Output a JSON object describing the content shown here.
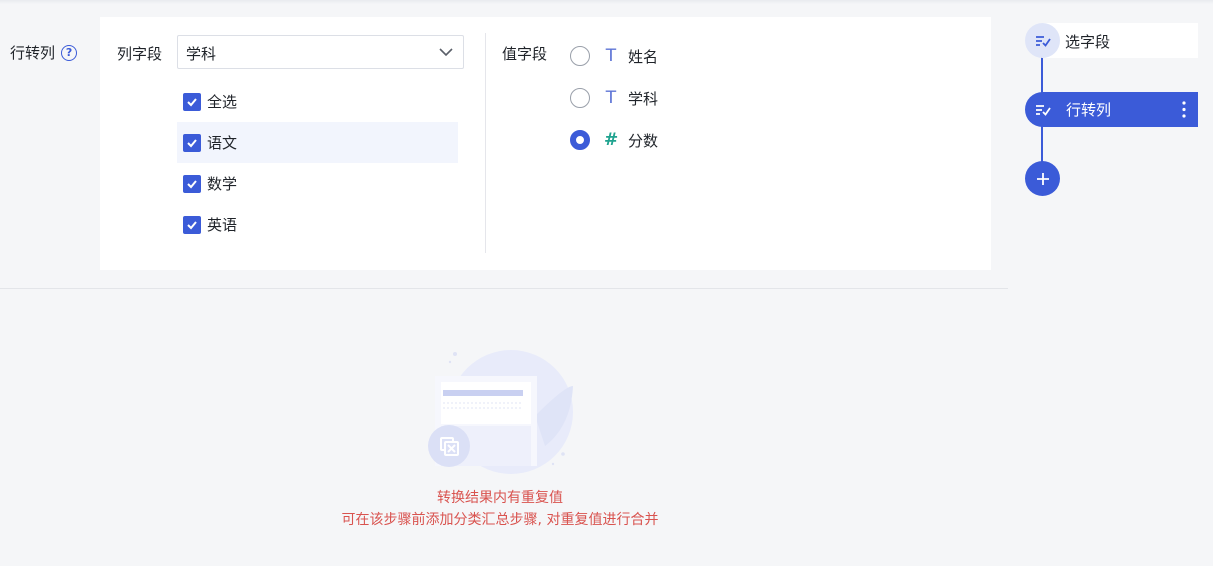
{
  "section": {
    "label": "行转列"
  },
  "column_field": {
    "label": "列字段",
    "selected": "学科",
    "options": [
      {
        "label": "全选",
        "checked": true
      },
      {
        "label": "语文",
        "checked": true
      },
      {
        "label": "数学",
        "checked": true
      },
      {
        "label": "英语",
        "checked": true
      }
    ]
  },
  "value_field": {
    "label": "值字段",
    "options": [
      {
        "label": "姓名",
        "type": "text",
        "type_symbol": "T",
        "selected": false
      },
      {
        "label": "学科",
        "type": "text",
        "type_symbol": "T",
        "selected": false
      },
      {
        "label": "分数",
        "type": "number",
        "type_symbol": "#",
        "selected": true
      }
    ]
  },
  "message": {
    "line1": "转换结果内有重复值",
    "line2": "可在该步骤前添加分类汇总步骤, 对重复值进行合并"
  },
  "steps": [
    {
      "label": "选字段",
      "active": false
    },
    {
      "label": "行转列",
      "active": true
    }
  ],
  "colors": {
    "accent": "#3b5bd8",
    "error": "#d9534f",
    "number_type": "#1fa38f"
  }
}
